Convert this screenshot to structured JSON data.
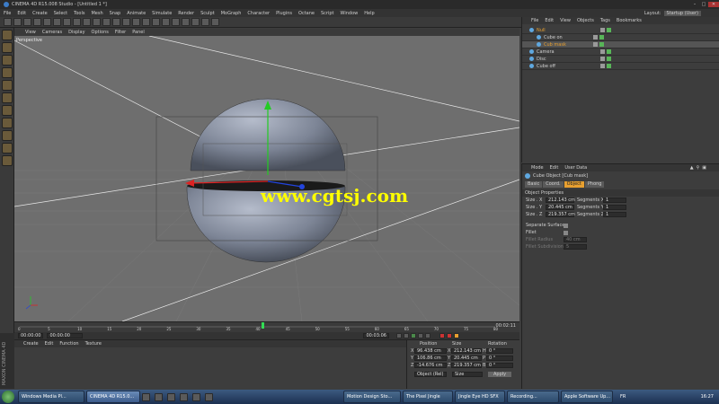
{
  "app": {
    "title": "CINEMA 4D R15.008 Studio - [Untitled 1 *]",
    "layout_label": "Layout:",
    "layout_value": "Startup (User)"
  },
  "menubar": [
    "File",
    "Edit",
    "Create",
    "Select",
    "Tools",
    "Mesh",
    "Snap",
    "Animate",
    "Simulate",
    "Render",
    "Sculpt",
    "MoGraph",
    "Character",
    "Plugins",
    "Octane",
    "Script",
    "Window",
    "Help"
  ],
  "viewport": {
    "menu": [
      "View",
      "Cameras",
      "Display",
      "Options",
      "Filter",
      "Panel"
    ],
    "label": "Perspective",
    "watermark": "www.cgtsj.com"
  },
  "objects_panel": {
    "menu": [
      "File",
      "Edit",
      "View",
      "Objects",
      "Tags",
      "Bookmarks"
    ],
    "items": [
      {
        "name": "Null",
        "level": 0,
        "selected": false
      },
      {
        "name": "Cube on",
        "level": 1,
        "selected": false
      },
      {
        "name": "Cub mask",
        "level": 1,
        "selected": true
      },
      {
        "name": "Camera",
        "level": 0,
        "selected": false
      },
      {
        "name": "Disc",
        "level": 0,
        "selected": false
      },
      {
        "name": "Cube off",
        "level": 0,
        "selected": false
      }
    ]
  },
  "attributes_panel": {
    "menu": [
      "Mode",
      "Edit",
      "User Data"
    ],
    "object_title": "Cube Object [Cub mask]",
    "tabs": [
      {
        "label": "Basic",
        "active": false
      },
      {
        "label": "Coord.",
        "active": false
      },
      {
        "label": "Object",
        "active": true
      },
      {
        "label": "Phong",
        "active": false
      }
    ],
    "section": "Object Properties",
    "rows": [
      {
        "label": "Size . X",
        "value": "212.143 cm",
        "seg_label": "Segments X",
        "seg_value": "1"
      },
      {
        "label": "Size . Y",
        "value": "20.445 cm",
        "seg_label": "Segments Y",
        "seg_value": "1"
      },
      {
        "label": "Size . Z",
        "value": "219.357 cm",
        "seg_label": "Segments Z",
        "seg_value": "1"
      }
    ],
    "separate_surfaces": "Separate Surfaces",
    "fillet": "Fillet",
    "fillet_radius": "Fillet Radius",
    "fillet_radius_value": "40 cm",
    "fillet_subdivision": "Fillet Subdivision",
    "fillet_subdivision_value": "5"
  },
  "timeline": {
    "ticks": [
      "0",
      "5",
      "10",
      "15",
      "20",
      "25",
      "30",
      "35",
      "40",
      "45",
      "50",
      "55",
      "60",
      "65",
      "70",
      "75",
      "80"
    ],
    "current_frame_start": "00:00:00",
    "current_frame_display": "00:00:00",
    "end_frame": "00:03:06",
    "frame_label": "00:02:11",
    "playhead_fraction": 0.508
  },
  "materials_panel": {
    "menu": [
      "Create",
      "Edit",
      "Function",
      "Texture"
    ]
  },
  "coords_panel": {
    "headers": [
      "Position",
      "Size",
      "Rotation"
    ],
    "rows": [
      {
        "axis": "X",
        "pos": "96.438 cm",
        "size_axis": "X",
        "size": "212.143 cm",
        "rot_axis": "H",
        "rot": "0 °"
      },
      {
        "axis": "Y",
        "pos": "106.86 cm",
        "size_axis": "Y",
        "size": "20.445 cm",
        "rot_axis": "P",
        "rot": "0 °"
      },
      {
        "axis": "Z",
        "pos": "-14.676 cm",
        "size_axis": "Z",
        "size": "219.357 cm",
        "rot_axis": "B",
        "rot": "0 °"
      }
    ],
    "mode_select": "Object (Rel)",
    "size_select": "Size",
    "apply": "Apply"
  },
  "side_brand": "MAXON CINEMA 4D",
  "taskbar": {
    "tasks": [
      {
        "label": "Windows Media Pl...",
        "active": false
      },
      {
        "label": "CINEMA 4D R15.0...",
        "active": true
      },
      {
        "label": "Motion Design Sto...",
        "active": false
      },
      {
        "label": "The Pixel Jingle",
        "active": false
      },
      {
        "label": "Jingle Eye HD SFX",
        "active": false
      },
      {
        "label": "Recording...",
        "active": false
      },
      {
        "label": "Apple Software Up...",
        "active": false
      }
    ],
    "lang": "FR",
    "clock": "16:27"
  },
  "colors": {
    "selected_tab": "#e8a030",
    "selection": "#e8a030",
    "watermark": "#ffff00",
    "axis_y": "#22cc22",
    "axis_x": "#dd2222",
    "axis_z": "#2244dd"
  }
}
